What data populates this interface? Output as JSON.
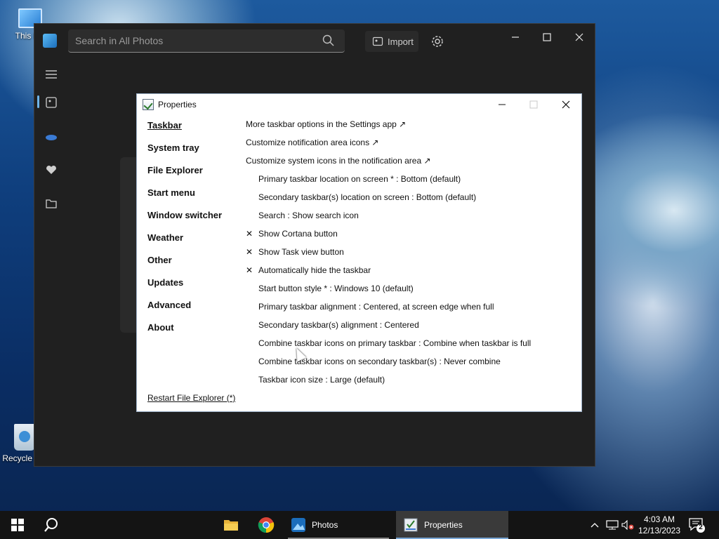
{
  "desktop": {
    "this_pc_label": "This PC",
    "recycle_bin_label": "Recycle Bin"
  },
  "photos": {
    "search_placeholder": "Search in All Photos",
    "import_label": "Import"
  },
  "properties": {
    "title": "Properties",
    "nav": [
      {
        "label": "Taskbar",
        "selected": true
      },
      {
        "label": "System tray"
      },
      {
        "label": "File Explorer"
      },
      {
        "label": "Start menu"
      },
      {
        "label": "Window switcher"
      },
      {
        "label": "Weather"
      },
      {
        "label": "Other"
      },
      {
        "label": "Updates"
      },
      {
        "label": "Advanced"
      },
      {
        "label": "About"
      }
    ],
    "options": [
      {
        "label": "More taskbar options in the Settings app ↗",
        "link": true
      },
      {
        "label": "Customize notification area icons ↗",
        "link": true
      },
      {
        "label": "Customize system icons in the notification area ↗",
        "link": true
      },
      {
        "mark": "",
        "label": "Primary taskbar location on screen * : Bottom (default)"
      },
      {
        "mark": "",
        "label": "Secondary taskbar(s) location on screen : Bottom (default)"
      },
      {
        "mark": "",
        "label": "Search : Show search icon"
      },
      {
        "mark": "✕",
        "label": "Show Cortana button"
      },
      {
        "mark": "✕",
        "label": "Show Task view button"
      },
      {
        "mark": "✕",
        "label": "Automatically hide the taskbar"
      },
      {
        "mark": "",
        "label": "Start button style * : Windows 10 (default)"
      },
      {
        "mark": "",
        "label": "Primary taskbar alignment : Centered, at screen edge when full"
      },
      {
        "mark": "",
        "label": "Secondary taskbar(s) alignment : Centered"
      },
      {
        "mark": "",
        "label": "Combine taskbar icons on primary taskbar : Combine when taskbar is full"
      },
      {
        "mark": "",
        "label": "Combine taskbar icons on secondary taskbar(s) : Never combine"
      },
      {
        "mark": "",
        "label": "Taskbar icon size : Large (default)"
      }
    ],
    "restart_label": "Restart File Explorer (*)"
  },
  "taskbar": {
    "photos_label": "Photos",
    "properties_label": "Properties",
    "time": "4:03 AM",
    "date": "12/13/2023",
    "notification_count": "2"
  }
}
